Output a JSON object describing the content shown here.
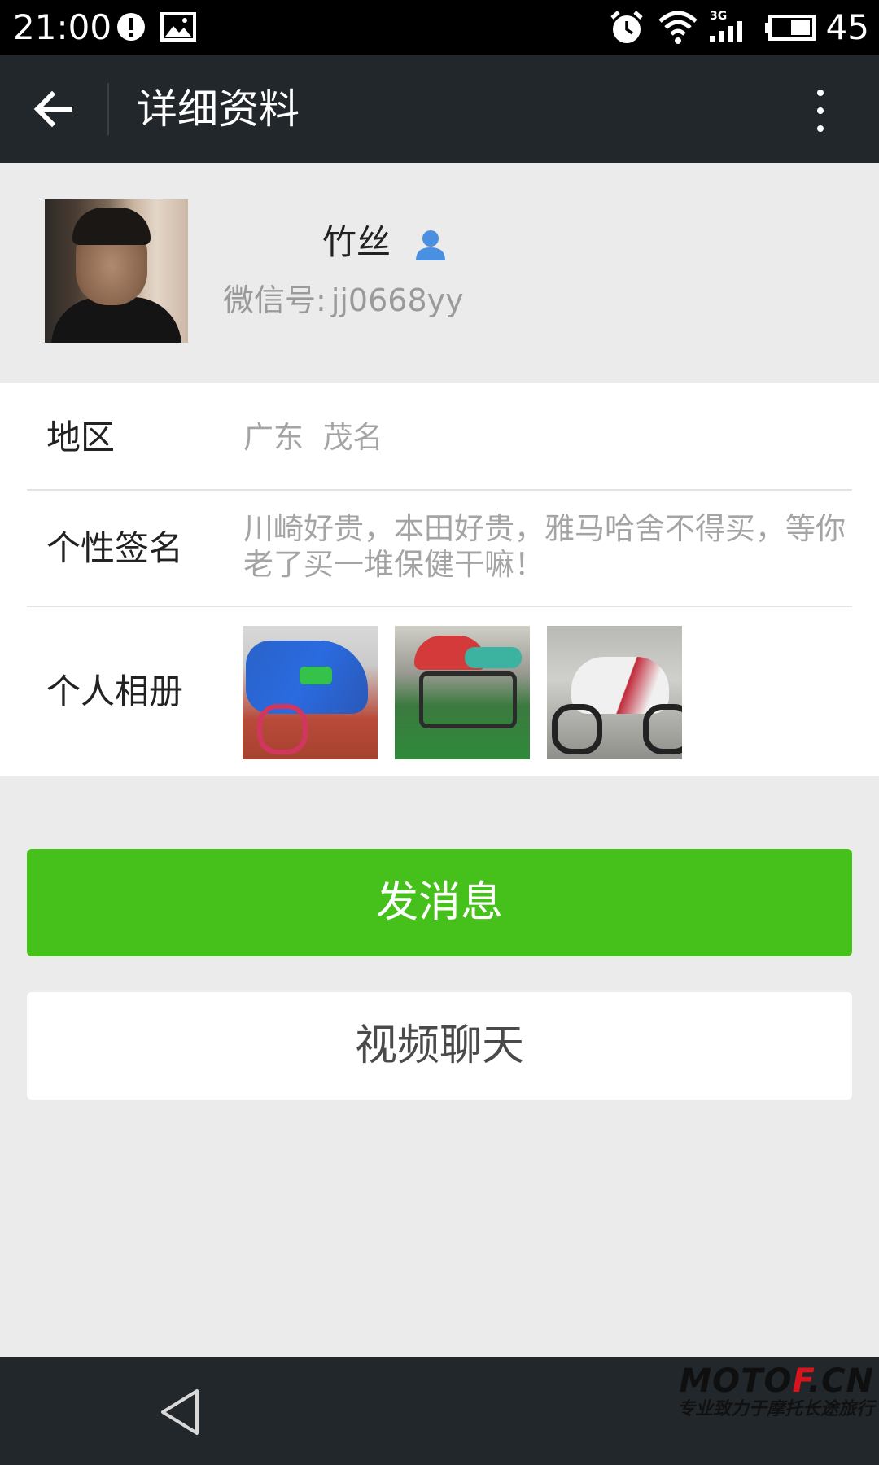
{
  "status_bar": {
    "time": "21:00",
    "battery_text": "45",
    "network_type": "3G",
    "icons": [
      "alert-icon",
      "image-icon",
      "alarm-icon",
      "wifi-icon",
      "signal-icon",
      "battery-icon"
    ]
  },
  "app_bar": {
    "title": "详细资料",
    "back_icon": "arrow-left-icon",
    "more_icon": "more-vertical-icon"
  },
  "profile": {
    "name": "竹丝",
    "wechat_id_label": "微信号:",
    "wechat_id": "jj0668yy",
    "contact_icon": "user-icon"
  },
  "info": {
    "region_label": "地区",
    "region_value": "广东  茂名",
    "signature_label": "个性签名",
    "signature_value": "川崎好贵，本田好贵，雅马哈舍不得买，等你老了买一堆保健干嘛！",
    "album_label": "个人相册",
    "album_photos": [
      "blue motorcycle",
      "red and teal motorcycle",
      "white and red motorcycle"
    ]
  },
  "actions": {
    "send_message": "发消息",
    "video_chat": "视频聊天"
  },
  "nav": {
    "back_icon": "nav-back-triangle-icon"
  },
  "watermark": {
    "logo_part1": "MOTO",
    "logo_part2": "F",
    "logo_part3": ".CN",
    "slogan": "专业致力于摩托长途旅行"
  },
  "colors": {
    "primary_green": "#46c01b",
    "app_bar": "#21272b",
    "background": "#ebebeb"
  }
}
